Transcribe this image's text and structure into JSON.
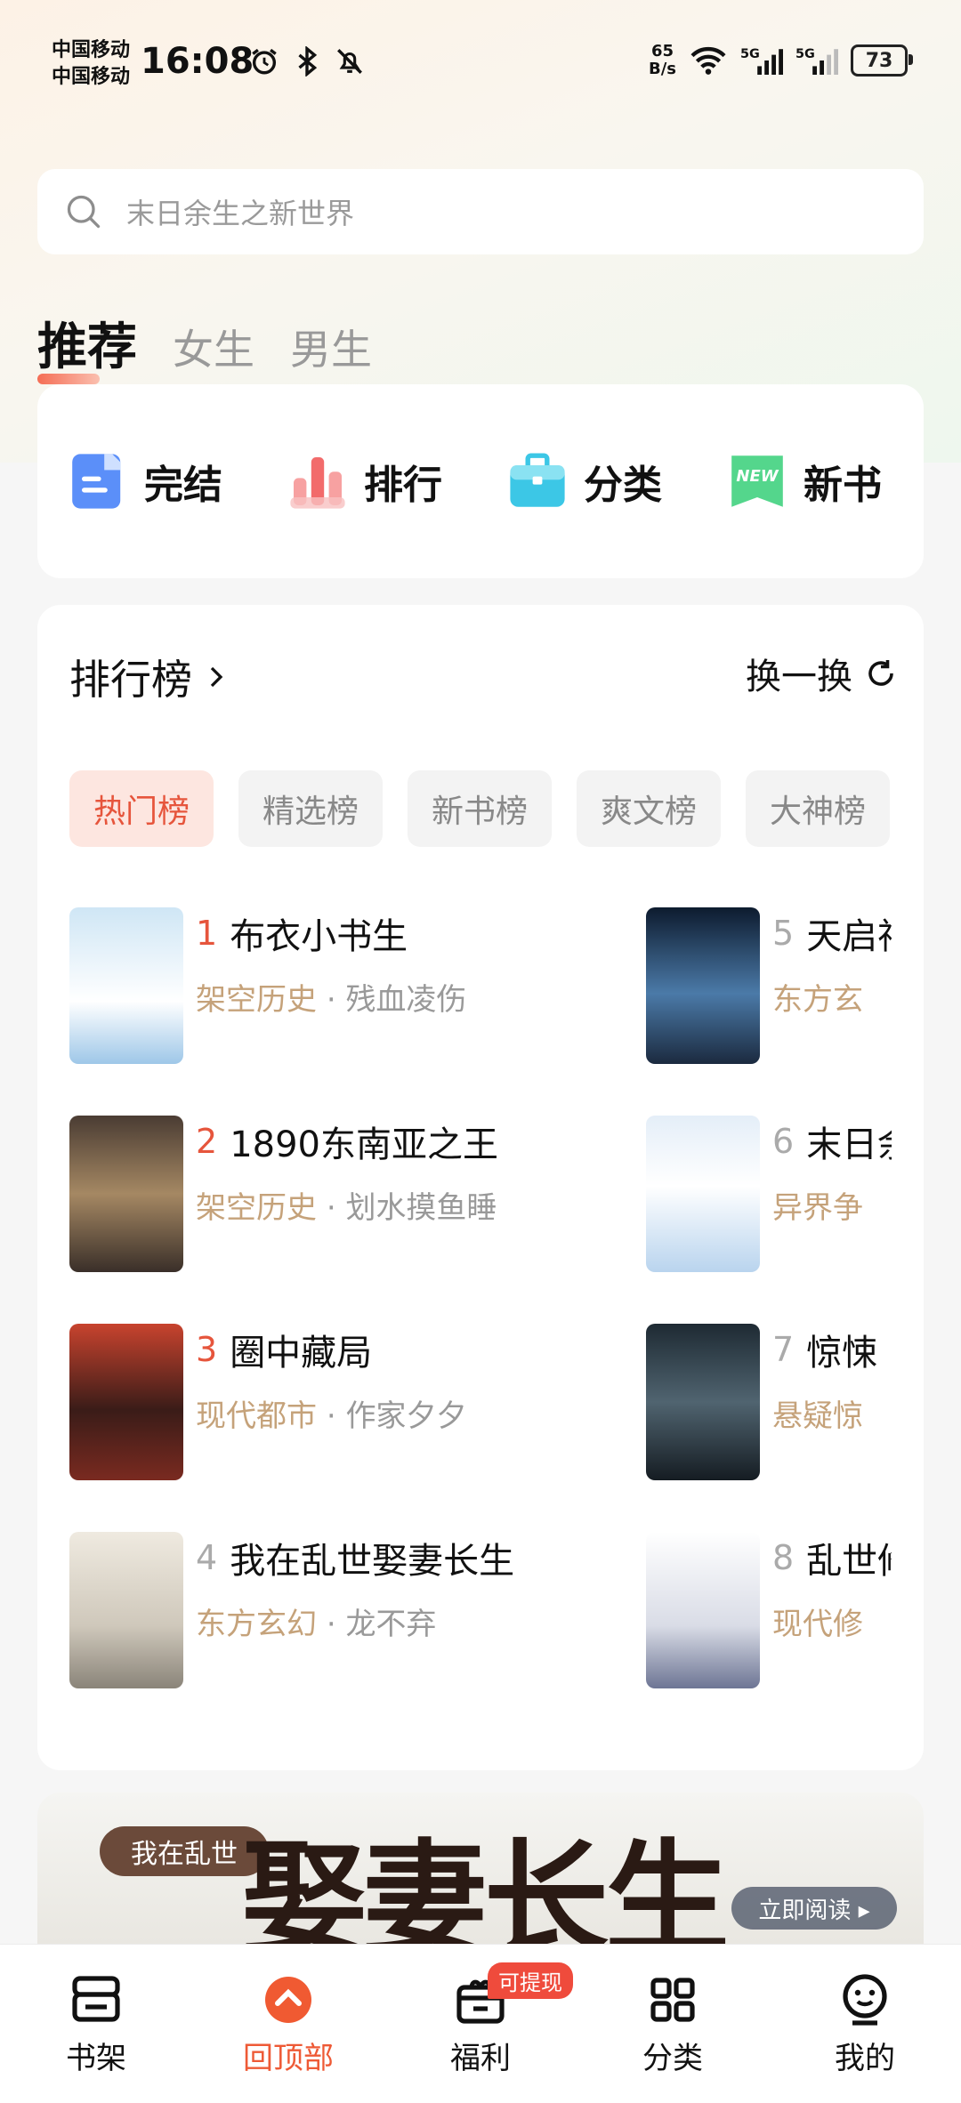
{
  "status": {
    "carrier1": "中国移动",
    "carrier2": "中国移动",
    "time": "16:08",
    "speed_value": "65",
    "speed_unit": "B/s",
    "battery": "73"
  },
  "search": {
    "placeholder": "末日余生之新世界"
  },
  "tabs": [
    {
      "label": "推荐",
      "active": true
    },
    {
      "label": "女生"
    },
    {
      "label": "男生"
    }
  ],
  "quick": [
    {
      "label": "完结",
      "icon": "document-icon",
      "color": "#5b8ff9"
    },
    {
      "label": "排行",
      "icon": "bar-chart-icon",
      "color": "#f26b6b"
    },
    {
      "label": "分类",
      "icon": "briefcase-icon",
      "color": "#3cc7e6"
    },
    {
      "label": "新书",
      "icon": "new-badge-icon",
      "color": "#54d68c"
    }
  ],
  "ranking": {
    "title": "排行榜",
    "refresh": "换一换",
    "chips": [
      "热门榜",
      "精选榜",
      "新书榜",
      "爽文榜",
      "大神榜"
    ],
    "books": [
      {
        "rank": "1",
        "title": "布衣小书生",
        "category": "架空历史",
        "author": "残血凌伤"
      },
      {
        "rank": "2",
        "title": "1890东南亚之王",
        "category": "架空历史",
        "author": "划水摸鱼睡"
      },
      {
        "rank": "3",
        "title": "圈中藏局",
        "category": "现代都市",
        "author": "作家夕夕"
      },
      {
        "rank": "4",
        "title": "我在乱世娶妻长生",
        "category": "东方玄幻",
        "author": "龙不弃"
      },
      {
        "rank": "5",
        "title": "天启神",
        "category": "东方玄",
        "author": ""
      },
      {
        "rank": "6",
        "title": "末日余",
        "category": "异界争",
        "author": ""
      },
      {
        "rank": "7",
        "title": "惊悚",
        "category": "悬疑惊",
        "author": ""
      },
      {
        "rank": "8",
        "title": "乱世修",
        "category": "现代修",
        "author": ""
      }
    ],
    "separator": "·"
  },
  "banner": {
    "subtitle": "我在乱世",
    "title": "娶妻长生",
    "button": "立即阅读 ▸"
  },
  "nav": [
    {
      "label": "书架",
      "icon": "bookshelf-icon"
    },
    {
      "label": "回顶部",
      "icon": "back-to-top-icon",
      "active": true
    },
    {
      "label": "福利",
      "icon": "gift-icon",
      "badge": "可提现"
    },
    {
      "label": "分类",
      "icon": "grid-icon"
    },
    {
      "label": "我的",
      "icon": "profile-icon"
    }
  ],
  "colors": {
    "accent": "#e6553c",
    "category": "#c5a27a"
  }
}
